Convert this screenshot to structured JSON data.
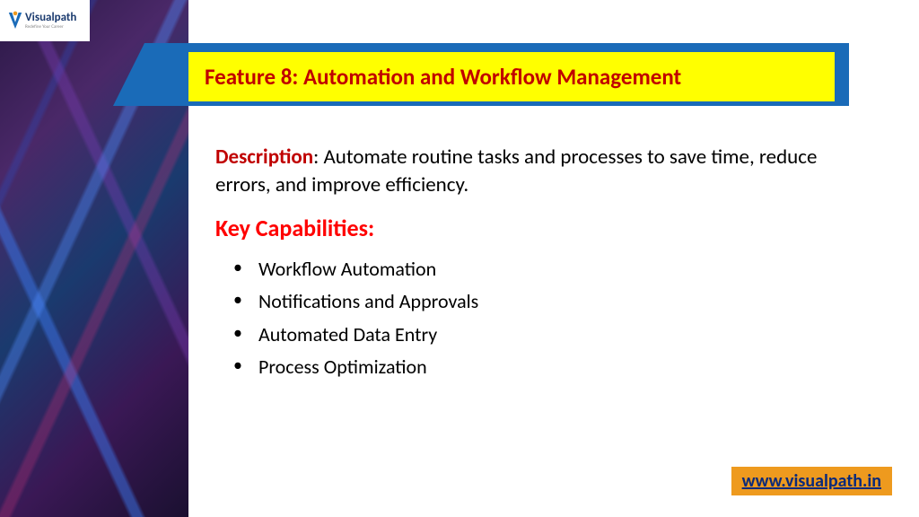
{
  "logo": {
    "name": "Visualpath",
    "tagline": "Redefine Your Career"
  },
  "title": "Feature 8: Automation and Workflow Management",
  "description": {
    "label": "Description",
    "text": ": Automate routine tasks and processes to save time, reduce errors, and improve efficiency."
  },
  "keyCapabilities": {
    "heading": "Key Capabilities:",
    "items": [
      "Workflow Automation",
      "Notifications and Approvals",
      "Automated Data Entry",
      "Process Optimization"
    ]
  },
  "link": "www.visualpath.in"
}
